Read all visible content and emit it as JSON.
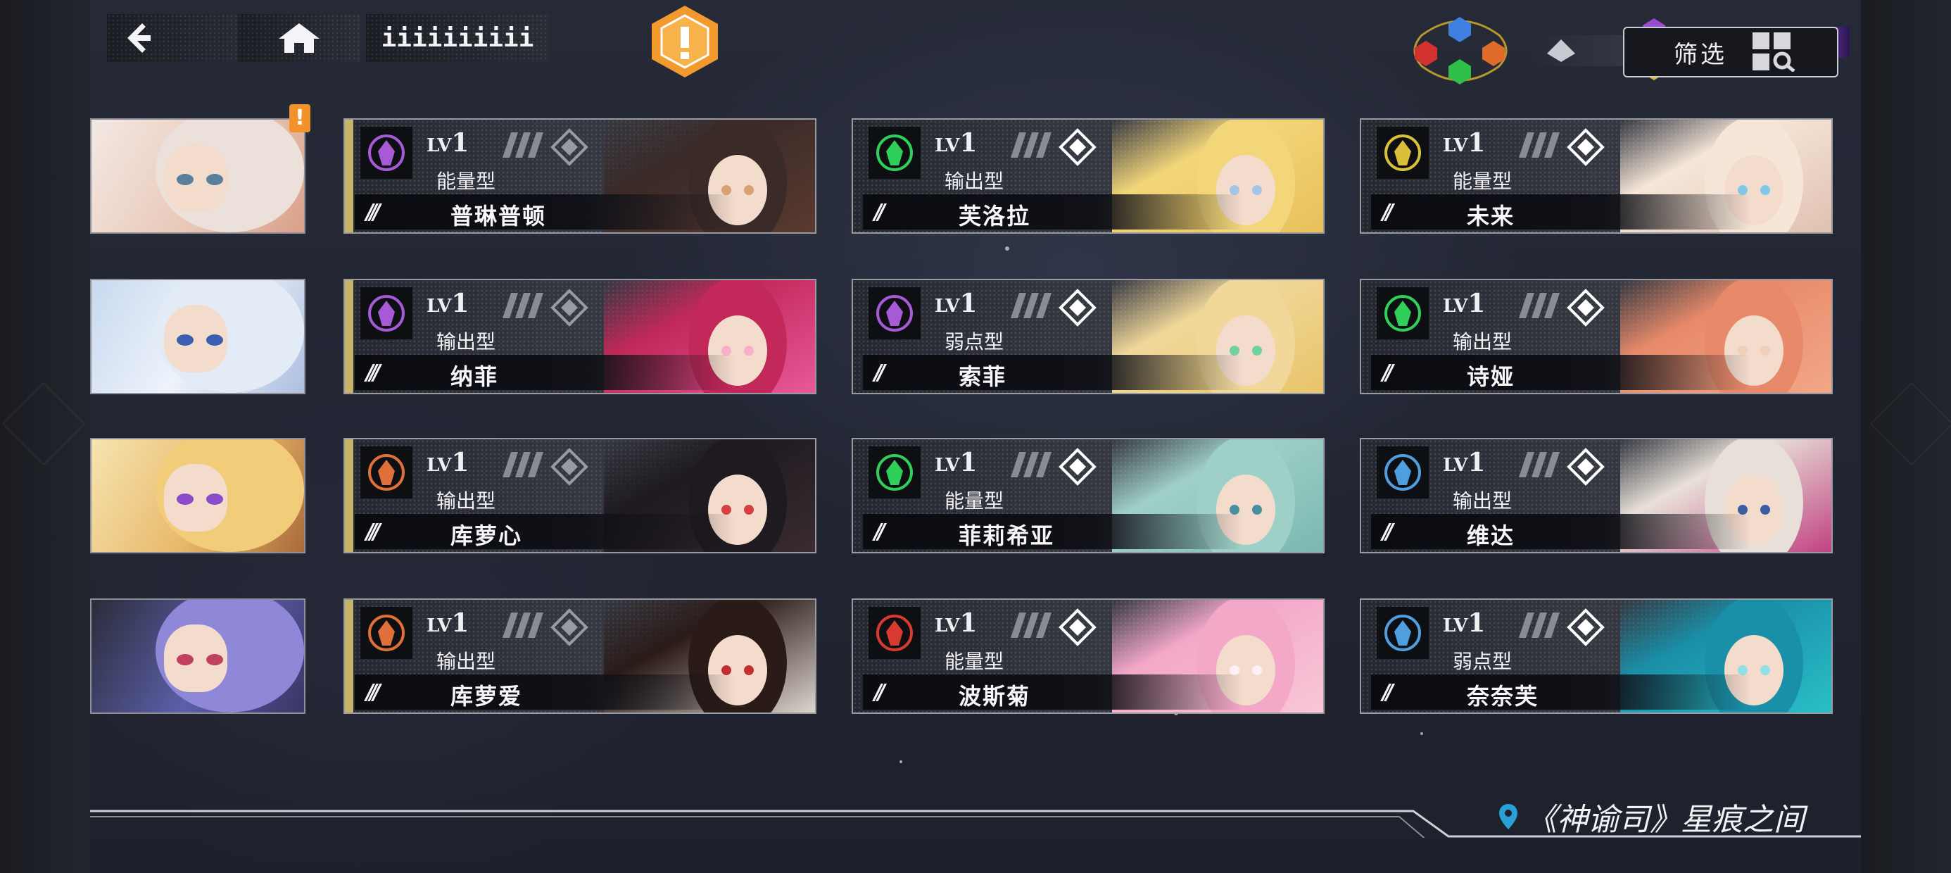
{
  "topbar": {
    "back_icon": "back-arrow-icon",
    "home_icon": "home-icon",
    "title": "iiiiiiiiii",
    "alert_icon": "exclamation-hex-icon"
  },
  "element_filters": [
    {
      "name": "crown",
      "color": "#6a8fe0"
    },
    {
      "name": "beast",
      "color": "#d2332f"
    },
    {
      "name": "flame",
      "color": "#e06b2a"
    },
    {
      "name": "tree",
      "color": "#2fbf4a"
    },
    {
      "name": "feather",
      "color": "#c9cbd2"
    },
    {
      "name": "purple",
      "color": "#9a4ccf"
    },
    {
      "name": "gold",
      "color": "#d6b73a"
    }
  ],
  "filter": {
    "label": "筛选",
    "icon": "grid-search-icon"
  },
  "badge": "!",
  "cards": [
    {
      "lv_prefix": "LV",
      "lv": "1",
      "type": "能量型",
      "name": "普琳普顿",
      "element": "crown-purple",
      "element_color": "#a65ad6",
      "arrows": "///",
      "rare": true
    },
    {
      "lv_prefix": "LV",
      "lv": "1",
      "type": "输出型",
      "name": "芙洛拉",
      "element": "tree-green",
      "element_color": "#2fcf5a",
      "arrows": "//",
      "rare": false
    },
    {
      "lv_prefix": "LV",
      "lv": "1",
      "type": "能量型",
      "name": "未来",
      "element": "trophy-gold",
      "element_color": "#d9bf3a",
      "arrows": "//",
      "rare": false
    },
    {
      "lv_prefix": "LV",
      "lv": "1",
      "type": "输出型",
      "name": "纳菲",
      "element": "crown-purple",
      "element_color": "#a65ad6",
      "arrows": "///",
      "rare": true
    },
    {
      "lv_prefix": "LV",
      "lv": "1",
      "type": "弱点型",
      "name": "索菲",
      "element": "crown-purple",
      "element_color": "#a65ad6",
      "arrows": "//",
      "rare": false
    },
    {
      "lv_prefix": "LV",
      "lv": "1",
      "type": "输出型",
      "name": "诗娅",
      "element": "tree-green",
      "element_color": "#2fcf5a",
      "arrows": "//",
      "rare": false
    },
    {
      "lv_prefix": "LV",
      "lv": "1",
      "type": "输出型",
      "name": "库萝心",
      "element": "beast-orange",
      "element_color": "#e0703a",
      "arrows": "///",
      "rare": true
    },
    {
      "lv_prefix": "LV",
      "lv": "1",
      "type": "能量型",
      "name": "菲莉希亚",
      "element": "tree-green",
      "element_color": "#2fcf5a",
      "arrows": "//",
      "rare": false
    },
    {
      "lv_prefix": "LV",
      "lv": "1",
      "type": "输出型",
      "name": "维达",
      "element": "shield-blue",
      "element_color": "#4f9fe0",
      "arrows": "//",
      "rare": false
    },
    {
      "lv_prefix": "LV",
      "lv": "1",
      "type": "输出型",
      "name": "库萝爱",
      "element": "beast-orange",
      "element_color": "#e0703a",
      "arrows": "///",
      "rare": true
    },
    {
      "lv_prefix": "LV",
      "lv": "1",
      "type": "能量型",
      "name": "波斯菊",
      "element": "wolf-red",
      "element_color": "#d83a30",
      "arrows": "//",
      "rare": false
    },
    {
      "lv_prefix": "LV",
      "lv": "1",
      "type": "弱点型",
      "name": "奈奈芙",
      "element": "shield-blue",
      "element_color": "#4f9fe0",
      "arrows": "//",
      "rare": false
    }
  ],
  "thumbnails": [
    {
      "name": "thumb-1",
      "hair": "#e6d8d0"
    },
    {
      "name": "thumb-2",
      "hair": "#dfe8f4"
    },
    {
      "name": "thumb-3",
      "hair": "#e8c06a"
    },
    {
      "name": "thumb-4",
      "hair": "#9b8ed9"
    }
  ],
  "footer": {
    "location_icon": "map-pin-icon",
    "location": "《神谕司》星痕之间"
  }
}
